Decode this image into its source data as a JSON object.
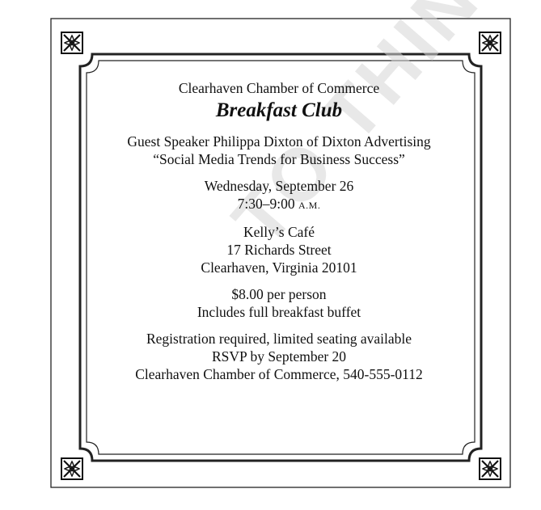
{
  "document": {
    "organization": "Clearhaven Chamber of Commerce",
    "event_title": "Breakfast Club",
    "speaker_line": "Guest Speaker Philippa Dixton of Dixton Advertising",
    "talk_title": "“Social Media Trends for Business Success”",
    "date": "Wednesday, September 26",
    "time_main": "7:30–9:00",
    "time_suffix": "A.M.",
    "venue_name": "Kelly’s Café",
    "venue_street": "17 Richards Street",
    "venue_city": "Clearhaven, Virginia 20101",
    "price": "$8.00 per person",
    "price_note": "Includes full breakfast buffet",
    "registration_note": "Registration required, limited seating available",
    "rsvp": "RSVP by September 20",
    "contact": "Clearhaven Chamber of Commerce, 540-555-0112"
  },
  "watermark": {
    "text": "TO THINH"
  },
  "corner_ornament_icon": "square-floral-ornament-icon"
}
